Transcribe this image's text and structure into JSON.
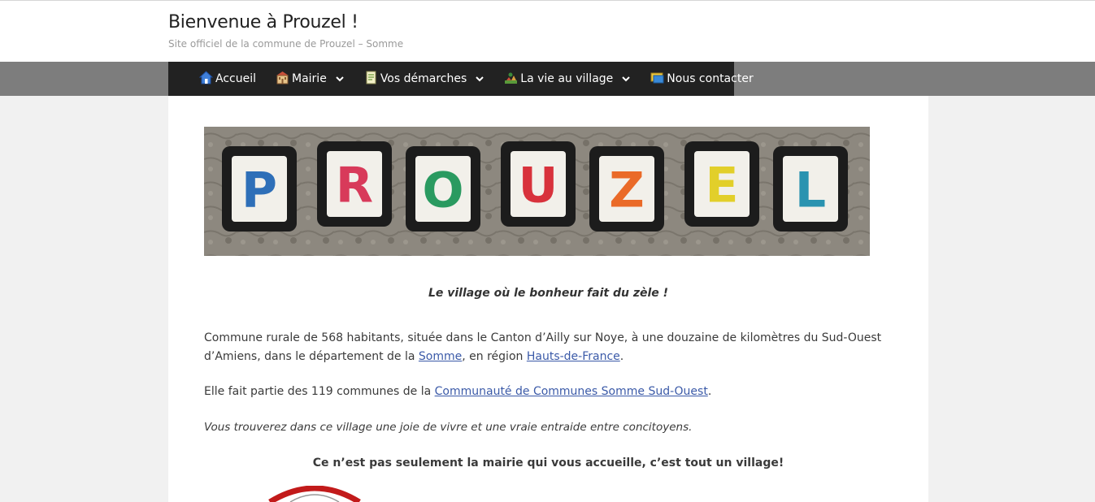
{
  "site": {
    "title": "Bienvenue à Prouzel !",
    "description": "Site officiel de la commune de Prouzel – Somme"
  },
  "nav": [
    {
      "label": "Accueil",
      "icon": "house-icon",
      "dropdown": false
    },
    {
      "label": "Mairie",
      "icon": "town-hall-icon",
      "dropdown": true
    },
    {
      "label": "Vos démarches",
      "icon": "document-icon",
      "dropdown": true
    },
    {
      "label": "La vie au village",
      "icon": "village-icon",
      "dropdown": true
    },
    {
      "label": "Nous contacter",
      "icon": "mail-icon",
      "dropdown": false
    }
  ],
  "banner": {
    "letters": [
      "P",
      "R",
      "O",
      "U",
      "Z",
      "E",
      "L"
    ],
    "colors": [
      "#2e6fb8",
      "#d83a5a",
      "#2a9a60",
      "#d8323c",
      "#ea6a28",
      "#e2cf2a",
      "#2a93b0"
    ]
  },
  "content": {
    "tagline": "Le village où le bonheur fait du zèle !",
    "p1_before": "Commune rurale de 568 habitants, située dans le Canton d’Ailly sur Noye, à une douzaine de kilomètres du Sud-Ouest d’Amiens, dans le département de la ",
    "p1_link1": "Somme",
    "p1_mid": ", en région ",
    "p1_link2": "Hauts-de-France",
    "p1_after": ".",
    "p2_before": "Elle fait partie des 119 communes de la ",
    "p2_link": "Communauté de Communes Somme Sud-Ouest",
    "p2_after": ".",
    "p3": "Vous trouverez dans ce village une joie de vivre et une vraie entraide entre concitoyens.",
    "p4": "Ce n’est pas seulement la mairie qui vous accueille, c’est tout un village!"
  },
  "colors": {
    "navbar": "#222222",
    "navband": "#7d7d7d",
    "link": "#3b5aa8",
    "page_bg": "#f1f1f1"
  }
}
